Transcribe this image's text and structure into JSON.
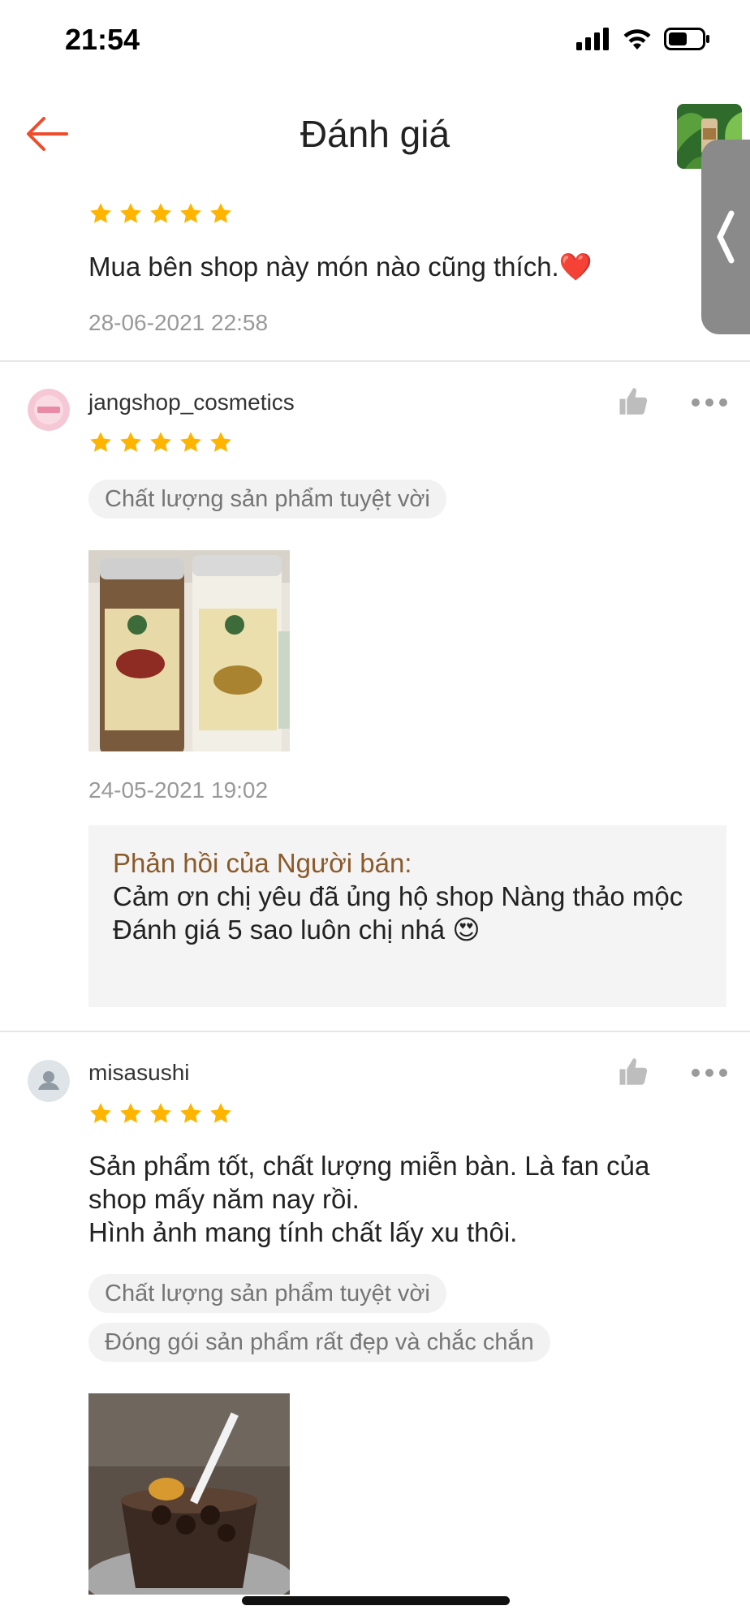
{
  "status_bar": {
    "time": "21:54"
  },
  "header": {
    "title": "Đánh giá"
  },
  "reviews": [
    {
      "text": "Mua bên shop này món nào cũng thích.❤️",
      "timestamp": "28-06-2021 22:58",
      "rating": 5
    },
    {
      "username": "jangshop_cosmetics",
      "rating": 5,
      "tags": [
        "Chất lượng sản phẩm tuyệt vời"
      ],
      "timestamp": "24-05-2021 19:02",
      "seller_reply": {
        "title": "Phản hồi của Người bán:",
        "text": "Cảm ơn chị yêu đã ủng hộ shop Nàng thảo mộc\nĐánh giá 5 sao luôn chị nhá 😍"
      }
    },
    {
      "username": "misasushi",
      "rating": 5,
      "text": "Sản phẩm tốt, chất lượng miễn bàn. Là fan của shop mấy năm nay rồi.\nHình ảnh mang tính chất lấy xu thôi.",
      "tags": [
        "Chất lượng sản phẩm tuyệt vời",
        "Đóng gói sản phẩm rất đẹp và chắc chắn"
      ]
    }
  ],
  "colors": {
    "accent": "#ee4d2d",
    "star": "#ffb400",
    "seller_reply_title": "#8b5a2b"
  }
}
